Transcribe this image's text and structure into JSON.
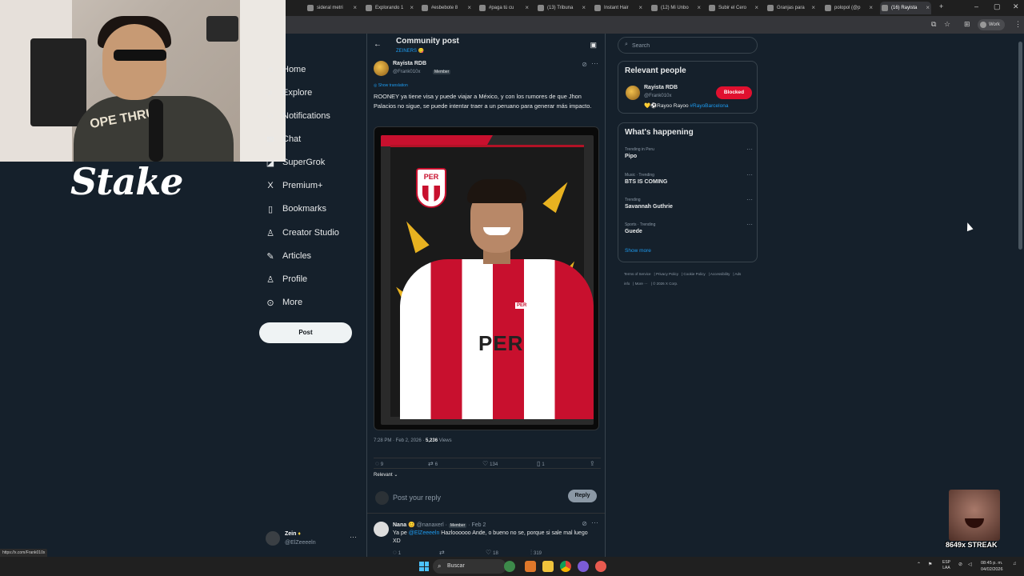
{
  "browser": {
    "tabs": [
      {
        "label": "sideral metri",
        "left": 0
      },
      {
        "label": "Explorando 1",
        "left": 0
      },
      {
        "label": "#esbebote 8",
        "left": 0
      },
      {
        "label": "#paga tú cu",
        "left": 0
      },
      {
        "label": "(13) Tribuna",
        "left": 0
      },
      {
        "label": "Instant Hair",
        "left": 0
      },
      {
        "label": "(12) Mi Unbo",
        "left": 0
      },
      {
        "label": "Subir el Cero",
        "left": 0
      },
      {
        "label": "Granjas para",
        "left": 0
      },
      {
        "label": "polopol (@p",
        "left": 0
      },
      {
        "label": "(16) Rayista",
        "left": 0
      }
    ],
    "profile_label": "Work",
    "status_url": "https://x.com/Frank010x"
  },
  "overlay": {
    "webcam_shirt_text": "OPE THRU",
    "sponsor_logo": "Stake",
    "streak_label": "8649x STREAK"
  },
  "nav": {
    "items": [
      {
        "label": "Home",
        "icon": "home-icon",
        "glyph": "⌂"
      },
      {
        "label": "Explore",
        "icon": "search-icon",
        "glyph": "⌕"
      },
      {
        "label": "Notifications",
        "icon": "bell-icon",
        "glyph": "♢"
      },
      {
        "label": "Chat",
        "icon": "chat-icon",
        "glyph": "✉"
      },
      {
        "label": "SuperGrok",
        "icon": "grok-icon",
        "glyph": "◪"
      },
      {
        "label": "Premium+",
        "icon": "x-logo-icon",
        "glyph": "X"
      },
      {
        "label": "Bookmarks",
        "icon": "bookmark-icon",
        "glyph": "▯"
      },
      {
        "label": "Creator Studio",
        "icon": "creator-icon",
        "glyph": "♙"
      },
      {
        "label": "Articles",
        "icon": "articles-icon",
        "glyph": "✎"
      },
      {
        "label": "Profile",
        "icon": "profile-icon",
        "glyph": "♙"
      },
      {
        "label": "More",
        "icon": "more-circle-icon",
        "glyph": "⊙"
      }
    ],
    "post_button": "Post",
    "account": {
      "name": "Zein",
      "handle": "@ElZeeeeln"
    }
  },
  "post": {
    "header_title": "Community post",
    "community": "ZEINERS 😋",
    "author_name": "Rayista RDB",
    "author_handle": "@Frank010x",
    "member_badge": "Member",
    "show_translation": "Show translation",
    "text": "ROONEY ya tiene visa y puede viajar a México, y con los rumores de que Jhon Palacios no sigue, se puede intentar traer a un peruano para generar más impacto.",
    "image": {
      "crest_label": "PER",
      "jersey_text": "PER"
    },
    "timestamp": "7:28 PM · Feb 2, 2026 · ",
    "views_count": "5,236",
    "views_label": " Views",
    "stats": {
      "replies": "9",
      "reposts": "6",
      "likes": "134",
      "bookmarks": "1"
    },
    "sort_label": "Relevant ⌄",
    "reply_placeholder": "Post your reply",
    "reply_button": "Reply"
  },
  "comment": {
    "name": "Nana 😊",
    "handle": "@nanaxerl · ",
    "member_badge": "Member",
    "date": " · Feb 2",
    "text_prefix": "Ya pe ",
    "mention": "@ElZeeeeln",
    "text_rest": " Hazloooooo Ande, o bueno no se, porque si sale mal luego XD",
    "stats": {
      "replies": "1",
      "reposts": "",
      "likes": "18",
      "views": "319"
    }
  },
  "sidebar": {
    "search_placeholder": "Search",
    "relevant_people_title": "Relevant people",
    "person": {
      "name": "Rayista RDB",
      "handle": "@Frank010x",
      "bio_prefix": "💛⚽Rayoo Rayoo ",
      "bio_tag": "#RayoBarcelona",
      "status_button": "Blocked"
    },
    "happening_title": "What's happening",
    "trends": [
      {
        "category": "Trending in Peru",
        "name": "Pipo"
      },
      {
        "category": "Music · Trending",
        "name": "BTS IS COMING"
      },
      {
        "category": "Trending",
        "name": "Savannah Guthrie"
      },
      {
        "category": "Sports · Trending",
        "name": "Guede"
      }
    ],
    "show_more": "Show more",
    "footer_links": [
      "Terms of Service",
      "Privacy Policy",
      "Cookie Policy",
      "Accessibility",
      "Ads info",
      "More ···",
      "© 2026 X Corp."
    ]
  },
  "taskbar": {
    "search_label": "Buscar",
    "lang_line1": "ESP",
    "lang_line2": "LAA",
    "time": "08:45 p. m.",
    "date": "04/02/2026"
  },
  "colors": {
    "background": "#15202b",
    "accent": "#1d9bf0",
    "blocked": "#e0102f",
    "peru_red": "#c8102e"
  }
}
